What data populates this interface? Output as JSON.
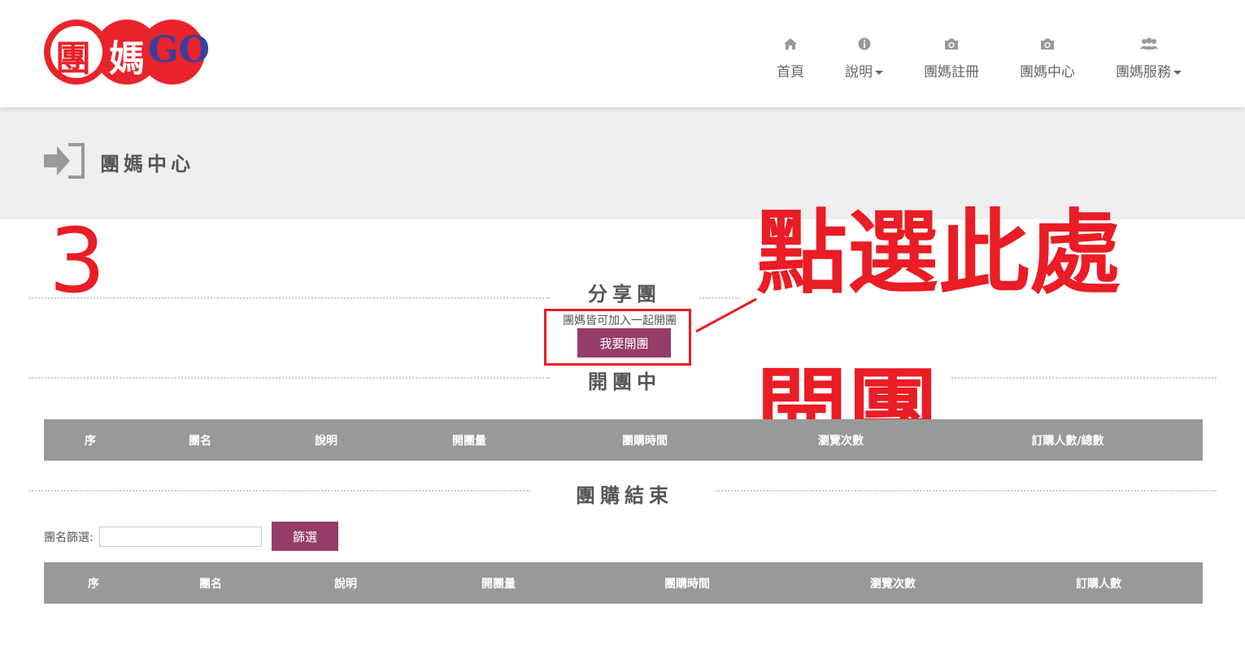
{
  "header": {
    "logo": {
      "char1": "團",
      "char2": "媽",
      "char3": "GO"
    },
    "nav": [
      {
        "label": "首頁",
        "icon": "home-icon",
        "dropdown": false
      },
      {
        "label": "說明",
        "icon": "info-icon",
        "dropdown": true
      },
      {
        "label": "團媽註冊",
        "icon": "camera-icon",
        "dropdown": false
      },
      {
        "label": "團媽中心",
        "icon": "camera-icon",
        "dropdown": false
      },
      {
        "label": "團媽服務",
        "icon": "users-icon",
        "dropdown": true
      }
    ]
  },
  "banner": {
    "title": "團媽中心",
    "icon": "sign-in-icon"
  },
  "annotations": {
    "step": "3",
    "instruction": "點選此處",
    "action": "開團",
    "color": "#ea1c24"
  },
  "share_section": {
    "title": "分享團",
    "description": "團媽皆可加入一起開團",
    "button_label": "我要開團"
  },
  "open_section": {
    "title": "開團中",
    "columns": [
      "序",
      "團名",
      "說明",
      "開團量",
      "團購時間",
      "瀏覽次數",
      "訂購人數/總數"
    ]
  },
  "ended_section": {
    "title": "團購結束",
    "filter_label": "團名篩選:",
    "filter_value": "",
    "filter_button": "篩選",
    "columns": [
      "序",
      "團名",
      "說明",
      "開團量",
      "團購時間",
      "瀏覽次數",
      "訂購人數"
    ]
  },
  "colors": {
    "accent": "#953d68",
    "table_header": "#999999",
    "logo_red": "#e8232b"
  }
}
